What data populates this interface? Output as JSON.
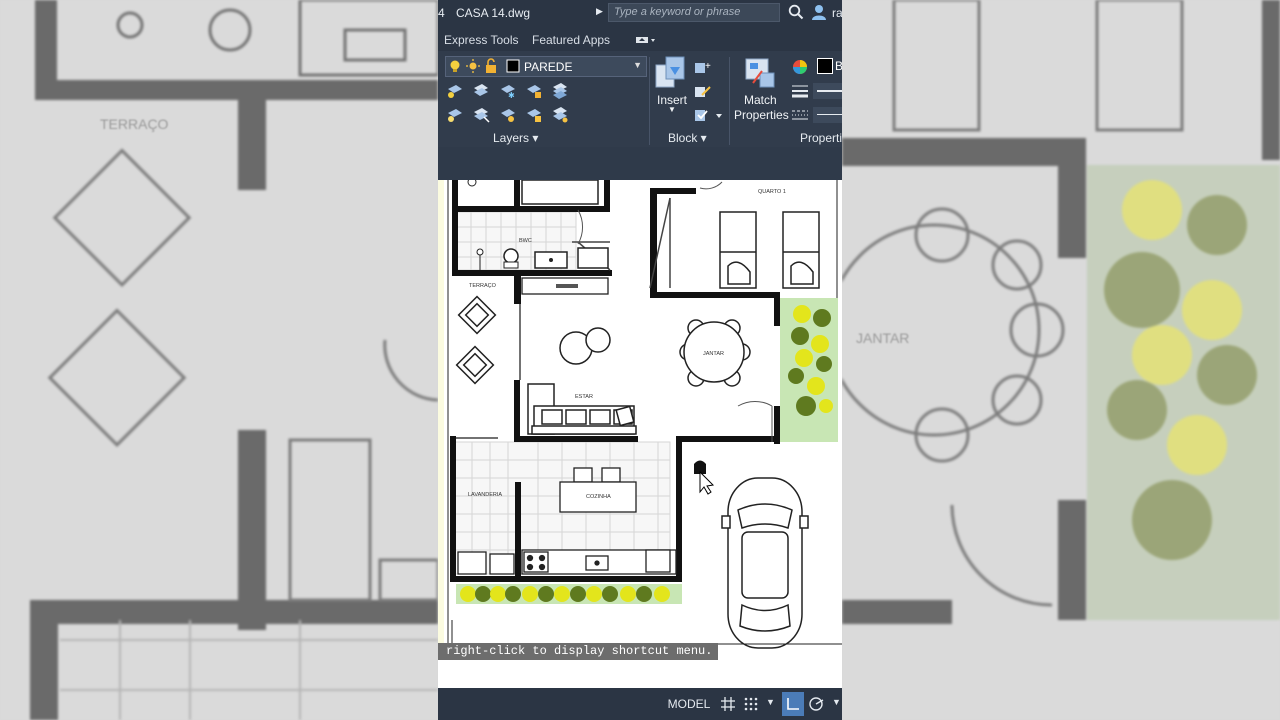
{
  "titlebar": {
    "prefix": "4",
    "file_name": "CASA 14.dwg",
    "search_placeholder": "Type a keyword or phrase",
    "user": "ra"
  },
  "tabs": [
    "Express Tools",
    "Featured Apps"
  ],
  "ribbon": {
    "layer_name": "PAREDE",
    "insert_label": "Insert",
    "match_label_1": "Match",
    "match_label_2": "Properties",
    "panel_layers": "Layers",
    "panel_block": "Block",
    "panel_properties": "Propertie",
    "color_letter": "B"
  },
  "drawing": {
    "rooms": {
      "quarto": "QUARTO 1",
      "bwc": "BWC",
      "terraco": "TERRAÇO",
      "jantar": "JANTAR",
      "estar": "ESTAR",
      "lavanderia": "LAVANDERIA",
      "cozinha": "COZINHA"
    }
  },
  "command_hint": "right-click to display shortcut menu.",
  "status": {
    "model": "MODEL"
  },
  "background": {
    "left_label": "TERRAÇO",
    "right_label": "JANTAR"
  },
  "colors": {
    "title_bg": "#2b3544",
    "ribbon_bg": "#313c4c",
    "plant_yellow": "#e3e51c",
    "plant_green": "#5f7a1f"
  }
}
